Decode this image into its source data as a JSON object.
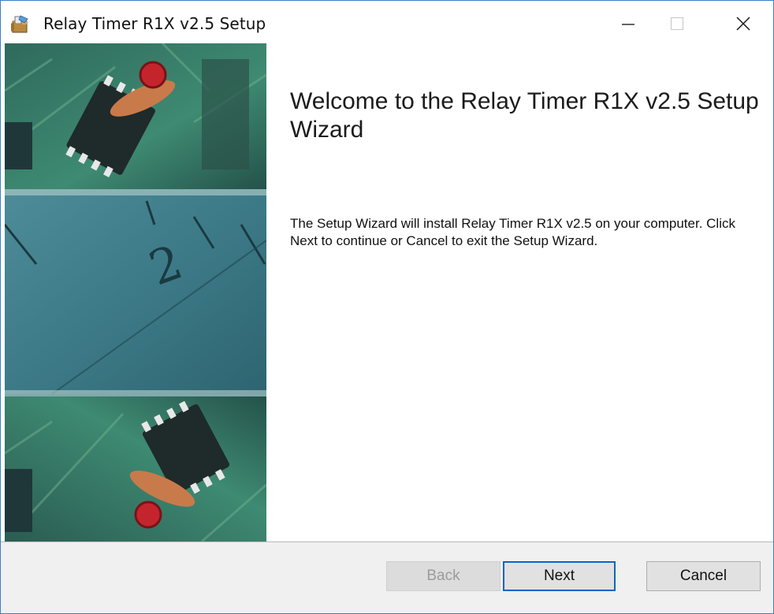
{
  "window": {
    "title": "Relay Timer R1X v2.5 Setup",
    "accent_color": "#3b7fc4"
  },
  "titlebar": {
    "icon": "installer-box-icon",
    "minimize_icon": "minimize-icon",
    "maximize_icon": "maximize-icon",
    "close_icon": "close-icon"
  },
  "content": {
    "heading": "Welcome to the Relay Timer R1X v2.5 Setup Wizard",
    "body": "The Setup Wizard will install Relay Timer R1X v2.5 on your computer. Click Next to continue or Cancel to exit the Setup Wizard."
  },
  "buttons": {
    "back_label": "Back",
    "back_enabled": false,
    "next_label": "Next",
    "cancel_label": "Cancel"
  }
}
